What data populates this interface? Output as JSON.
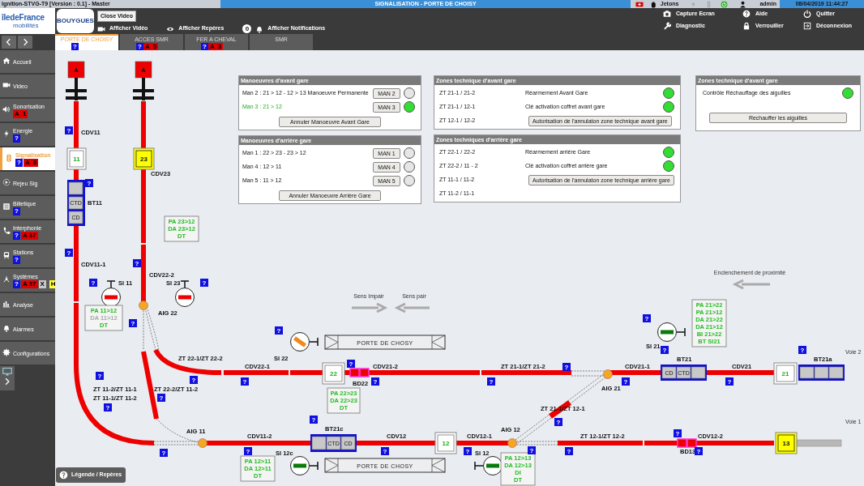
{
  "header": {
    "app_title": "Ignition-STVG-T9 [Version : 0.1] - Master",
    "screen_title": "SIGNALISATION - PORTE DE CHOISY",
    "tokens_label": "Jetons",
    "user": "admin",
    "datetime": "08/04/2019 11:44:27"
  },
  "logos": {
    "region": "îledeFrance",
    "region_subtitle": "mobilités",
    "partner": "BOUYGUES"
  },
  "close_video": "Close Video",
  "toolbar": [
    {
      "kind": "video",
      "label": "Afficher Vidéo"
    },
    {
      "kind": "marks",
      "label": "Afficher Repères"
    },
    {
      "kind": "notifications",
      "label": "Afficher Notifications",
      "count": "0"
    }
  ],
  "actions": [
    {
      "kind": "capture",
      "label": "Capture Ecran"
    },
    {
      "kind": "help",
      "label": "Aide"
    },
    {
      "kind": "quit",
      "label": "Quitter"
    },
    {
      "kind": "diagnostic",
      "label": "Diagnostic"
    },
    {
      "kind": "lock",
      "label": "Verrouiller"
    },
    {
      "kind": "logout",
      "label": "Déconnexion"
    }
  ],
  "tabs": [
    {
      "label": "PORTE DE CHOISY",
      "selected": true,
      "badges": [
        {
          "kind": "help",
          "text": "?"
        }
      ]
    },
    {
      "label": "ACCES SMR",
      "selected": false,
      "badges": [
        {
          "kind": "help",
          "text": "?"
        },
        {
          "kind": "alarm",
          "text": "A  5"
        }
      ]
    },
    {
      "label": "FER A CHEVAL",
      "selected": false,
      "badges": [
        {
          "kind": "help",
          "text": "?"
        },
        {
          "kind": "alarm",
          "text": "A  3"
        }
      ]
    },
    {
      "label": "SMR",
      "selected": false
    }
  ],
  "sidebar": {
    "items": [
      {
        "label": "Accueil",
        "selected": false
      },
      {
        "label": "Video",
        "selected": false
      },
      {
        "label": "Sonorisation",
        "selected": false,
        "badges": [
          {
            "kind": "alarm",
            "text": "A  1"
          }
        ]
      },
      {
        "label": "Energie",
        "selected": false,
        "badges": [
          {
            "kind": "help",
            "text": "?"
          }
        ]
      },
      {
        "label": "Signalisation",
        "selected": true,
        "badges": [
          {
            "kind": "help",
            "text": "?"
          },
          {
            "kind": "alarm",
            "text": "A  8"
          }
        ]
      },
      {
        "label": "Rejeu Sig",
        "selected": false
      },
      {
        "label": "Billetique",
        "selected": false,
        "badges": [
          {
            "kind": "help",
            "text": "?"
          }
        ]
      },
      {
        "label": "Interphonie",
        "selected": false,
        "badges": [
          {
            "kind": "help",
            "text": "?"
          },
          {
            "kind": "alarm",
            "text": "A 37"
          }
        ]
      },
      {
        "label": "Stations",
        "selected": false,
        "badges": [
          {
            "kind": "help",
            "text": "?"
          }
        ]
      },
      {
        "label": "Systèmes",
        "selected": false,
        "badges": [
          {
            "kind": "help",
            "text": "?"
          },
          {
            "kind": "alarm",
            "text": "A 37"
          },
          {
            "kind": "ack",
            "text": "X"
          },
          {
            "kind": "hold",
            "text": "H"
          }
        ]
      },
      {
        "label": "Analyse",
        "selected": false
      },
      {
        "label": "Alarmes",
        "selected": false
      },
      {
        "label": "Configurations",
        "selected": false
      }
    ]
  },
  "panels": [
    {
      "title": "Manoeuvres d'avant gare",
      "rows": [
        {
          "kind": "maneuver",
          "label": "Man 2 : 21 > 12 - 12 > 13 Manoeuvre Permanente",
          "button": "MAN 2",
          "lit": false
        },
        {
          "kind": "maneuver",
          "label": "Man 3 : 21 > 12",
          "button": "MAN 3",
          "lit": true
        }
      ],
      "action": "Annuler Manoeuvre Avant Gare"
    },
    {
      "title": "Manoeuvres d'arrière gare",
      "rows": [
        {
          "kind": "maneuver",
          "label": "Man 1 : 22 > 23 - 23 > 12",
          "button": "MAN 1",
          "lit": false
        },
        {
          "kind": "maneuver",
          "label": "Man 4 : 12 > 11",
          "button": "MAN 4",
          "lit": false
        },
        {
          "kind": "maneuver",
          "label": "Man 5 : 11 > 12",
          "button": "MAN 5",
          "lit": false
        }
      ],
      "action": "Annuler Manoeuvre Arrière Gare"
    },
    {
      "title": "Zones technique d'avant gare",
      "rows": [
        {
          "kind": "status",
          "label": "ZT 21-1 / 21-2",
          "status": "Réarmement Avant Gare",
          "lit": true
        },
        {
          "kind": "status",
          "label": "ZT 21-1 / 12-1",
          "status": "Clé activation coffret avant gare",
          "lit": true
        },
        {
          "kind": "zone_action",
          "label": "ZT 12-1 / 12-2",
          "button": "Autorisation de l'annulaton zone technique avant gare"
        }
      ]
    },
    {
      "title": "Zones techniques d'arrière gare",
      "rows": [
        {
          "kind": "status",
          "label": "ZT 22-1 / 22-2",
          "status": "Réarmement arrière Gare",
          "lit": true
        },
        {
          "kind": "status",
          "label": "ZT 22-2 / 11 - 2",
          "status": "Clé activation coffret arrière gare",
          "lit": true
        },
        {
          "kind": "zone_action",
          "label": "ZT 11-1 / 11-2",
          "button": "Autorisation de l'annulaton zone technique arrière gare"
        },
        {
          "kind": "zone",
          "label": "ZT 11-2 / 11-1"
        }
      ]
    },
    {
      "title": "Zones technique d'avant gare",
      "rows": [
        {
          "kind": "check",
          "label": "Contrôle Réchauffage des aiguilles",
          "lit": true
        }
      ],
      "action": "Rechauffer les aiguilles"
    }
  ],
  "diagram": {
    "termini": [
      "A",
      "A"
    ],
    "zone_labels": [
      "CDV11",
      "CDV23",
      "CDV11-1",
      "CDV22-2",
      "ZT 22-1/ZT 22-2",
      "ZT 11-2/ZT 11-1",
      "ZT 11-1/ZT 11-2",
      "ZT 22-2/ZT 11-2",
      "CDV22-1",
      "CDV21-2",
      "BD22",
      "ZT 21-1/ZT 21-2",
      "CDV21-1",
      "CDV21",
      "ZT 21-1/ZT 12-1",
      "CDV11-2",
      "CDV12",
      "CDV12-1",
      "ZT 12-1/ZT 12-2",
      "CDV12-2",
      "BD13"
    ],
    "switches": [
      "AIG 22",
      "AIG 11",
      "AIG 21",
      "AIG 12"
    ],
    "signals": [
      {
        "label": "SI 11",
        "kind": "stop"
      },
      {
        "label": "SI 23",
        "kind": "stop"
      },
      {
        "label": "SI 22",
        "kind": "transition"
      },
      {
        "label": "SI 21",
        "kind": "open"
      },
      {
        "label": "SI 12c",
        "kind": "open"
      },
      {
        "label": "SI 12",
        "kind": "open"
      }
    ],
    "number_boxes": [
      {
        "label": "11",
        "highlighted": false
      },
      {
        "label": "23",
        "highlighted": true
      },
      {
        "label": "22",
        "highlighted": false
      },
      {
        "label": "12",
        "highlighted": false
      },
      {
        "label": "21",
        "highlighted": false
      },
      {
        "label": "13",
        "highlighted": true
      }
    ],
    "blocks": [
      {
        "label": "BT11",
        "cells": [
          {
            "kind": "blank"
          },
          {
            "kind": "text",
            "text": "CTD"
          },
          {
            "kind": "text",
            "text": "CD"
          }
        ]
      },
      {
        "label": "BT21c",
        "cells": [
          {
            "kind": "blank"
          },
          {
            "kind": "text",
            "text": "CTD"
          },
          {
            "kind": "text",
            "text": "CD"
          }
        ]
      },
      {
        "label": "BT21",
        "cells": [
          {
            "kind": "text",
            "text": "CD"
          },
          {
            "kind": "text",
            "text": "CTD"
          },
          {
            "kind": "blank"
          }
        ]
      },
      {
        "label": "BT21a",
        "cells": [
          {
            "kind": "blank"
          },
          {
            "kind": "blank"
          },
          {
            "kind": "blank"
          }
        ]
      }
    ],
    "routes": [
      {
        "lines": [
          {
            "text": "PA 11>12",
            "active": true
          },
          {
            "text": "DA 11>12",
            "active": false
          },
          {
            "text": "DT",
            "active": true
          }
        ]
      },
      {
        "lines": [
          {
            "text": "PA 23>12",
            "active": true
          },
          {
            "text": "DA 23>12",
            "active": true
          },
          {
            "text": "DT",
            "active": true
          }
        ]
      },
      {
        "lines": [
          {
            "text": "PA 22>23",
            "active": true
          },
          {
            "text": "DA 22>23",
            "active": true
          },
          {
            "text": "DT",
            "active": true
          }
        ]
      },
      {
        "lines": [
          {
            "text": "PA 12>11",
            "active": true
          },
          {
            "text": "DA 12>11",
            "active": true
          },
          {
            "text": "DT",
            "active": true
          }
        ]
      },
      {
        "lines": [
          {
            "text": "PA 12>13",
            "active": true
          },
          {
            "text": "DA 12>13",
            "active": true
          },
          {
            "text": "DI",
            "active": true
          },
          {
            "text": "DT",
            "active": true
          }
        ]
      },
      {
        "lines": [
          {
            "text": "PA 21>22",
            "active": true
          },
          {
            "text": "PA 21>12",
            "active": true
          },
          {
            "text": "DA 21>22",
            "active": true
          },
          {
            "text": "DA 21>12",
            "active": true
          },
          {
            "text": "BI 21>22",
            "active": true
          },
          {
            "text": "BT SI21",
            "active": true
          }
        ]
      }
    ],
    "platforms": [
      "PORTE DE CHOSY",
      "PORTE DE CHOSY"
    ],
    "directions": [
      {
        "label": "Sens Impair",
        "kind": "right"
      },
      {
        "label": "Sens pair",
        "kind": "left"
      },
      {
        "label": "Enclenchement de proximité",
        "kind": "left"
      }
    ],
    "track_names": [
      "Voie 2",
      "Voie 1"
    ],
    "help_markers": [
      "?",
      "?",
      "?",
      "?",
      "?",
      "?",
      "?",
      "?",
      "?",
      "?",
      "?",
      "?",
      "?",
      "?",
      "?",
      "?",
      "?",
      "?",
      "?",
      "?",
      "?",
      "?",
      "?",
      "?",
      "?",
      "?",
      "?",
      "?",
      "?",
      "?",
      "?",
      "?"
    ]
  },
  "legend_button": "Légende / Repères"
}
